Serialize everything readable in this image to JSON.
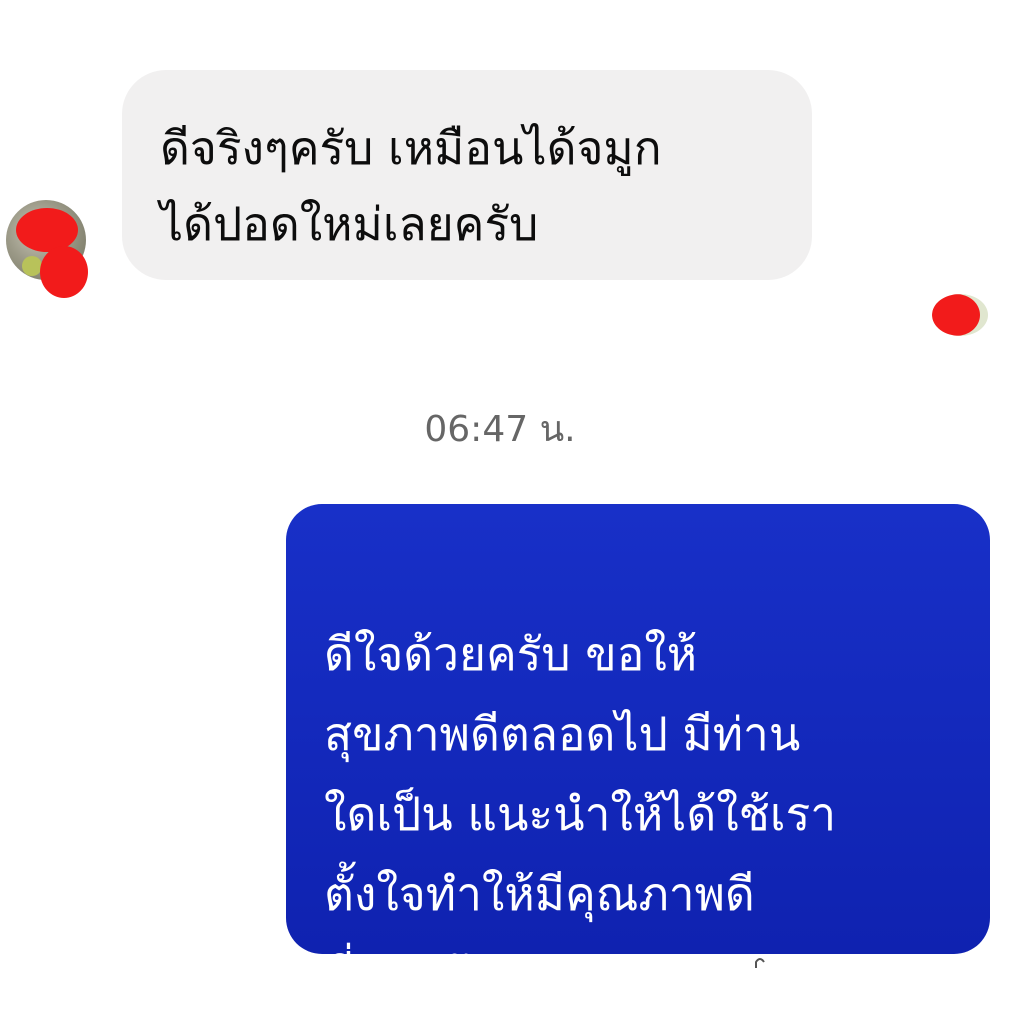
{
  "messages": {
    "incoming": {
      "text": "ดีจริงๆครับ เหมือนได้จมูก\nได้ปอดใหม่เลยครับ"
    },
    "timestamp": "06:47 น.",
    "outgoing": {
      "text": "ดีใจด้วยครับ ขอให้\nสุขภาพดีตลอดไป มีท่าน\nใดเป็น แนะนำให้ได้ใช้เรา\nตั้งใจทำให้มีคุณภาพดี\nที่สุดครับ"
    }
  },
  "colors": {
    "incoming_bubble": "#f1f0f0",
    "outgoing_bubble": "#1830c8",
    "timestamp_text": "#666666"
  }
}
